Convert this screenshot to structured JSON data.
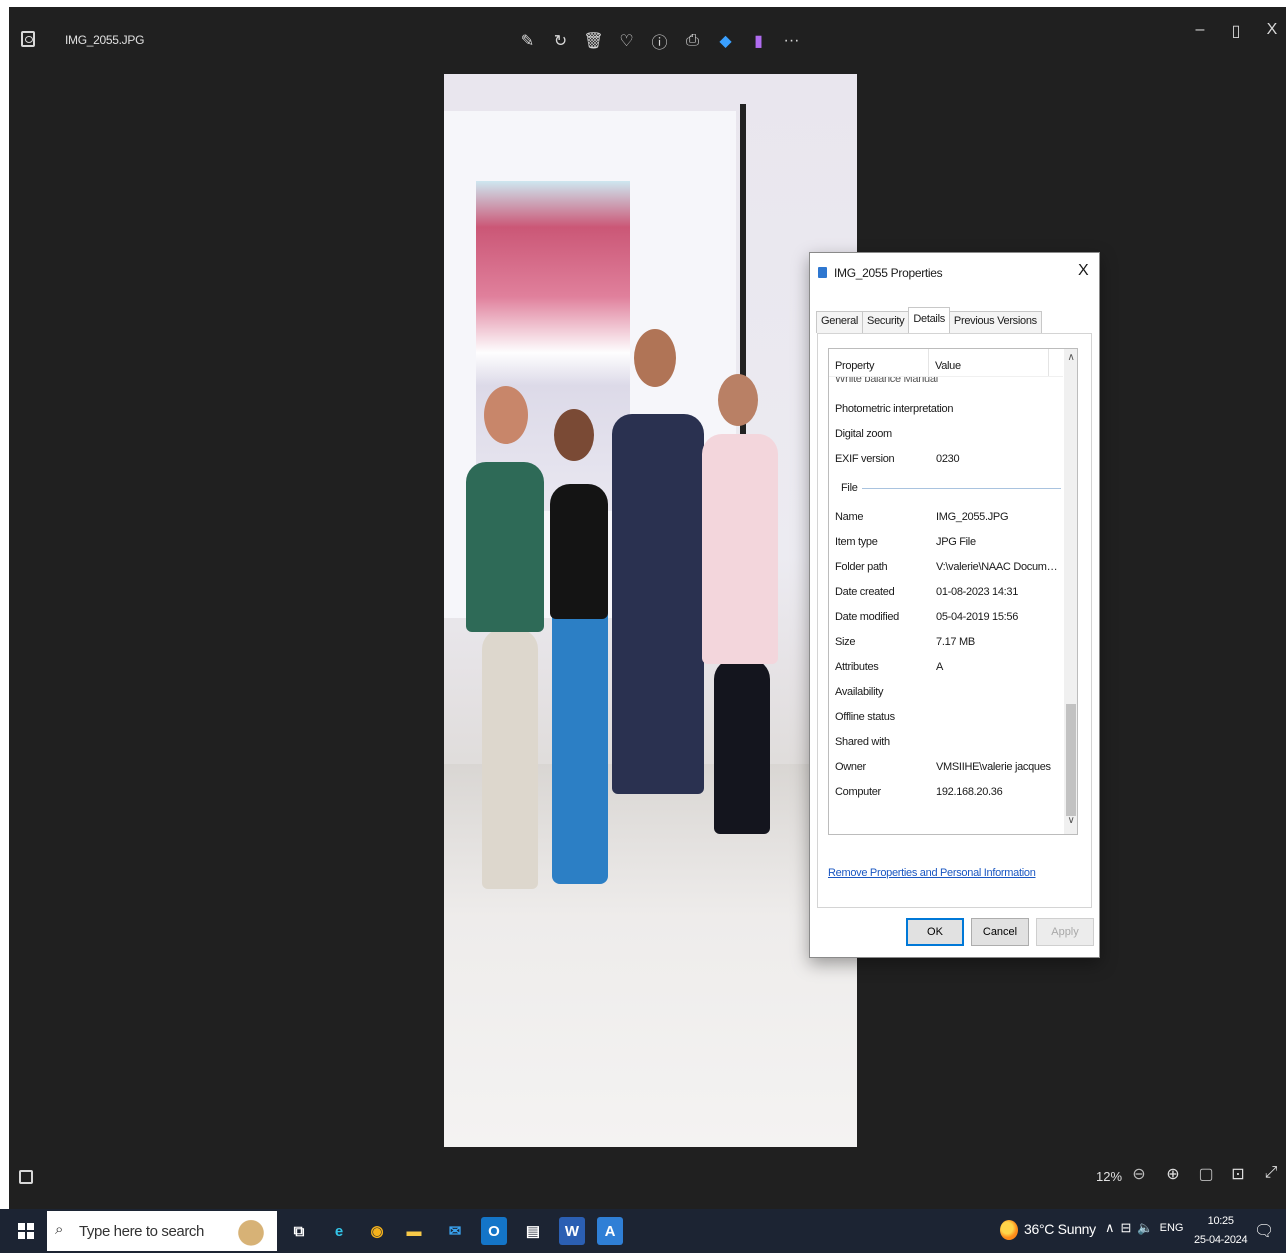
{
  "viewer": {
    "file_title": "IMG_2055.JPG",
    "toolbar": [
      {
        "name": "edit-icon",
        "glyph": "✎"
      },
      {
        "name": "rotate-icon",
        "glyph": "↻"
      },
      {
        "name": "delete-icon",
        "glyph": "🗑"
      },
      {
        "name": "favorite-icon",
        "glyph": "♡"
      },
      {
        "name": "info-icon",
        "glyph": "ⓘ"
      },
      {
        "name": "print-icon",
        "glyph": "⎙"
      },
      {
        "name": "photo-app-icon",
        "glyph": "◆"
      },
      {
        "name": "clipchamp-icon",
        "glyph": "▮"
      },
      {
        "name": "more-icon",
        "glyph": "···"
      }
    ],
    "window_controls": {
      "minimize": "–",
      "maximize": "▯",
      "close": "X"
    },
    "zoom": "12%"
  },
  "dialog": {
    "title": "IMG_2055 Properties",
    "close": "X",
    "tabs": [
      "General",
      "Security",
      "Details",
      "Previous Versions"
    ],
    "active_tab": "Details",
    "headers": {
      "property": "Property",
      "value": "Value"
    },
    "cut_row": "White balance   Manual",
    "rows_top": [
      {
        "k": "Photometric interpretation",
        "v": ""
      },
      {
        "k": "Digital zoom",
        "v": ""
      },
      {
        "k": "EXIF version",
        "v": "0230"
      }
    ],
    "section": "File",
    "rows_file": [
      {
        "k": "Name",
        "v": "IMG_2055.JPG"
      },
      {
        "k": "Item type",
        "v": "JPG File"
      },
      {
        "k": "Folder path",
        "v": "V:\\valerie\\NAAC Documen..."
      },
      {
        "k": "Date created",
        "v": "01-08-2023 14:31"
      },
      {
        "k": "Date modified",
        "v": "05-04-2019 15:56"
      },
      {
        "k": "Size",
        "v": "7.17 MB"
      },
      {
        "k": "Attributes",
        "v": "A"
      },
      {
        "k": "Availability",
        "v": ""
      },
      {
        "k": "Offline status",
        "v": ""
      },
      {
        "k": "Shared with",
        "v": ""
      },
      {
        "k": "Owner",
        "v": "VMSIIHE\\valerie jacques"
      },
      {
        "k": "Computer",
        "v": "192.168.20.36"
      }
    ],
    "remove_link": "Remove Properties and Personal Information",
    "buttons": {
      "ok": "OK",
      "cancel": "Cancel",
      "apply": "Apply"
    }
  },
  "taskbar": {
    "search_placeholder": "Type here to search",
    "weather": "36°C  Sunny",
    "language": "ENG",
    "time": "10:25",
    "date": "25-04-2024",
    "apps": [
      {
        "name": "task-view-icon",
        "glyph": "⧉",
        "color": "#ffffff",
        "bg": "transparent"
      },
      {
        "name": "edge-icon",
        "glyph": "e",
        "color": "#33c4e8",
        "bg": "transparent"
      },
      {
        "name": "chrome-icon",
        "glyph": "◉",
        "color": "#f5b21c",
        "bg": "transparent"
      },
      {
        "name": "file-explorer-icon",
        "glyph": "▬",
        "color": "#f7c948",
        "bg": "transparent"
      },
      {
        "name": "mail-icon",
        "glyph": "✉",
        "color": "#3aa3f0",
        "bg": "transparent"
      },
      {
        "name": "outlook-icon",
        "glyph": "O",
        "color": "#ffffff",
        "bg": "#1475c8"
      },
      {
        "name": "calculator-icon",
        "glyph": "▤",
        "color": "#ffffff",
        "bg": "transparent"
      },
      {
        "name": "word-icon",
        "glyph": "W",
        "color": "#ffffff",
        "bg": "#2b5fb3"
      },
      {
        "name": "azure-icon",
        "glyph": "A",
        "color": "#ffffff",
        "bg": "#2f7fd6"
      }
    ]
  }
}
